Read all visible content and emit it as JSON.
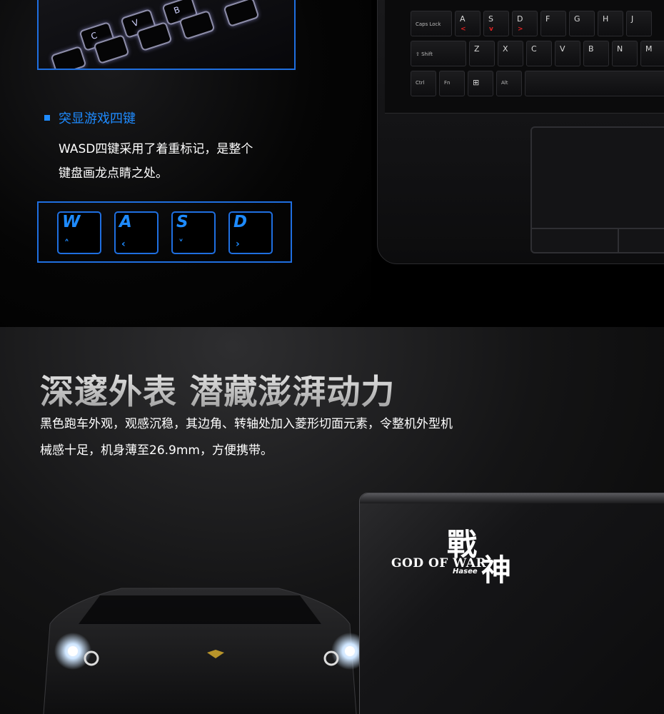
{
  "keyboard_photo": {
    "keys": [
      "C",
      "V",
      "B"
    ]
  },
  "feature": {
    "title": "突显游戏四键",
    "description_line1": "WASD四键采用了着重标记，是整个",
    "description_line2": "键盘画龙点睛之处。",
    "keys": [
      {
        "letter": "W",
        "arrow": "˄"
      },
      {
        "letter": "A",
        "arrow": "‹"
      },
      {
        "letter": "S",
        "arrow": "˅"
      },
      {
        "letter": "D",
        "arrow": "›"
      }
    ]
  },
  "laptop_keyboard": {
    "row1": [
      {
        "label": "Caps Lock",
        "small": true
      },
      {
        "label": "A",
        "arrow": "<"
      },
      {
        "label": "S",
        "arrow": "v"
      },
      {
        "label": "D",
        "arrow": ">"
      },
      {
        "label": "F"
      },
      {
        "label": "G"
      },
      {
        "label": "H"
      },
      {
        "label": "J"
      }
    ],
    "row2": [
      {
        "label": "⇧ Shift",
        "small": true
      },
      {
        "label": "Z"
      },
      {
        "label": "X"
      },
      {
        "label": "C"
      },
      {
        "label": "V"
      },
      {
        "label": "B"
      },
      {
        "label": "N"
      },
      {
        "label": "M"
      }
    ],
    "row3": [
      {
        "label": "Ctrl",
        "small": true
      },
      {
        "label": "Fn",
        "small": true
      },
      {
        "label": "⊞",
        "small": false
      },
      {
        "label": "Alt",
        "small": true
      }
    ]
  },
  "section": {
    "headline": "深邃外表 潜藏澎湃动力",
    "body_line1": "黑色跑车外观，观感沉稳，其边角、转轴处加入菱形切面元素，令整机外型机",
    "body_line2": "械感十足，机身薄至26.9mm，方便携带。"
  },
  "lid_logo": {
    "english": "GOD OF WAR",
    "char1": "戰",
    "char2": "神",
    "brand": "Hasee"
  },
  "colors": {
    "accent_blue": "#1e8bff",
    "frame_blue": "#1f6fe0",
    "arrow_red": "#dd2222",
    "background": "#000000"
  }
}
